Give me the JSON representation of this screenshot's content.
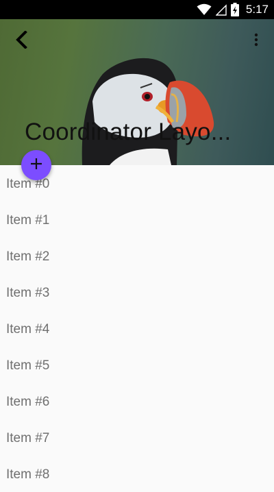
{
  "status_bar": {
    "time": "5:17",
    "icons": [
      "wifi-icon",
      "cell-signal-icon",
      "battery-charging-icon"
    ]
  },
  "app_bar": {
    "title": "Coordinator Layo...",
    "back_icon": "back-arrow-icon",
    "overflow_icon": "more-vert-icon"
  },
  "fab": {
    "icon": "plus-icon",
    "color": "#7c4dff"
  },
  "list": {
    "items": [
      "Item #0",
      "Item #1",
      "Item #2",
      "Item #3",
      "Item #4",
      "Item #5",
      "Item #6",
      "Item #7",
      "Item #8"
    ]
  }
}
